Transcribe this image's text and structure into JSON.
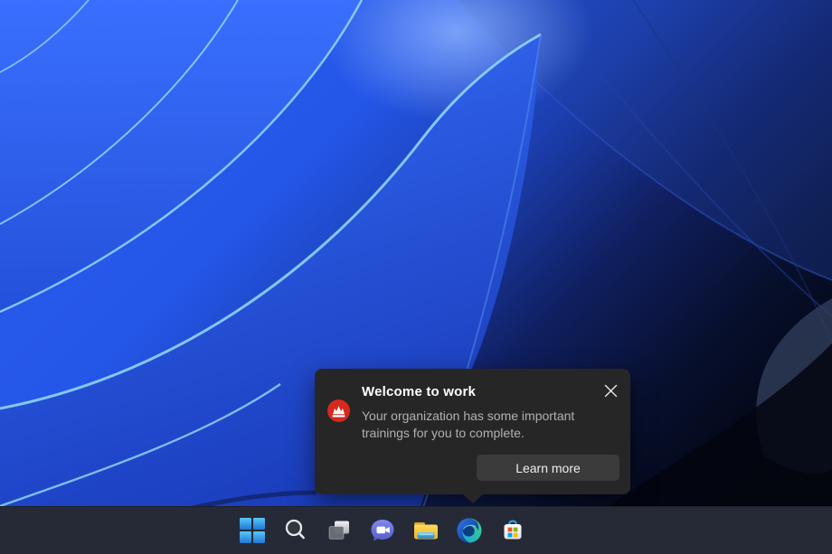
{
  "notification": {
    "title": "Welcome to work",
    "body": "Your organization has some important trainings for you to complete.",
    "action_label": "Learn more",
    "icons": {
      "app_badge": "training-mountain-badge-icon",
      "close": "close-x-icon"
    },
    "colors": {
      "background": "#262626",
      "button_background": "#3b3b3b",
      "title_text": "#ffffff",
      "body_text": "#b1b1b1",
      "badge_background": "#d7281d"
    }
  },
  "taskbar": {
    "background": "#252a36",
    "items": [
      {
        "id": "start",
        "name": "Start",
        "icon": "windows-logo-icon"
      },
      {
        "id": "search",
        "name": "Search",
        "icon": "search-icon"
      },
      {
        "id": "task-view",
        "name": "Task View",
        "icon": "task-view-icon"
      },
      {
        "id": "chat",
        "name": "Chat",
        "icon": "video-chat-bubble-icon"
      },
      {
        "id": "file-explorer",
        "name": "File Explorer",
        "icon": "folder-icon"
      },
      {
        "id": "edge",
        "name": "Microsoft Edge",
        "icon": "edge-browser-icon"
      },
      {
        "id": "store",
        "name": "Microsoft Store",
        "icon": "store-bag-icon"
      }
    ]
  },
  "wallpaper": {
    "name": "windows-11-bloom",
    "colors": {
      "bright_blue": "#2b5cee",
      "edge_highlight": "#8fd2ff",
      "dark_navy": "#060d20",
      "near_black": "#02050e"
    }
  }
}
